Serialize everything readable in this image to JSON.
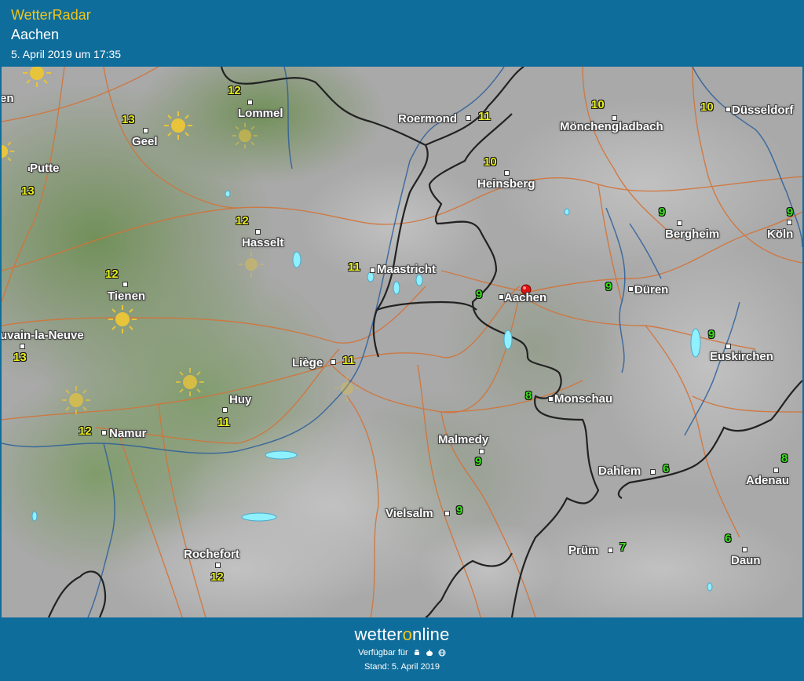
{
  "header": {
    "app_title": "WetterRadar",
    "location": "Aachen",
    "timestamp": "5. April 2019 um 17:35"
  },
  "map": {
    "marker_city": "Aachen",
    "towns": {
      "lommel": "Lommel",
      "roermond": "Roermond",
      "moenchengladbach": "Mönchengladbach",
      "duesseldorf": "Düsseldorf",
      "geel": "Geel",
      "putte": "Putte",
      "heinsberg": "Heinsberg",
      "hasselt": "Hasselt",
      "maastricht": "Maastricht",
      "bergheim": "Bergheim",
      "koeln": "Köln",
      "tienen": "Tienen",
      "aachen": "Aachen",
      "dueren": "Düren",
      "louvain": "uvain-la-Neuve",
      "liege": "Liège",
      "euskirchen": "Euskirchen",
      "huy": "Huy",
      "monschau": "Monschau",
      "namur": "Namur",
      "malmedy": "Malmedy",
      "dahlem": "Dahlem",
      "adenau": "Adenau",
      "vielsalm": "Vielsalm",
      "pruem": "Prüm",
      "daun": "Daun",
      "rochefort": "Rochefort",
      "edge_en": "en"
    },
    "temps": {
      "lommel": "12",
      "roermond": "11",
      "moenchengladbach": "10",
      "duesseldorf": "10",
      "geel": "13",
      "putte": "13",
      "heinsberg": "10",
      "hasselt": "12",
      "maastricht": "11",
      "bergheim": "9",
      "koeln": "9",
      "tienen": "12",
      "aachen": "9",
      "dueren": "9",
      "louvain": "13",
      "liege": "11",
      "euskirchen": "9",
      "huy": "11",
      "monschau": "8",
      "namur": "12",
      "malmedy": "9",
      "dahlem": "6",
      "adenau": "8",
      "vielsalm": "9",
      "pruem": "7",
      "daun": "6",
      "rochefort": "12"
    },
    "colors": {
      "warm_temp": "#e9ef18",
      "cool_temp": "#38e01a",
      "borders": "#222222",
      "roads": "#d2743a",
      "rivers": "#2d5f9a",
      "rain": "#8ff0ff"
    }
  },
  "footer": {
    "brand_part1": "wetter",
    "brand_part2": "o",
    "brand_part3": "nline",
    "available": "Verfügbar für",
    "platform_icons": [
      "android-icon",
      "apple-icon",
      "web-icon"
    ],
    "as_of": "Stand: 5. April 2019"
  }
}
